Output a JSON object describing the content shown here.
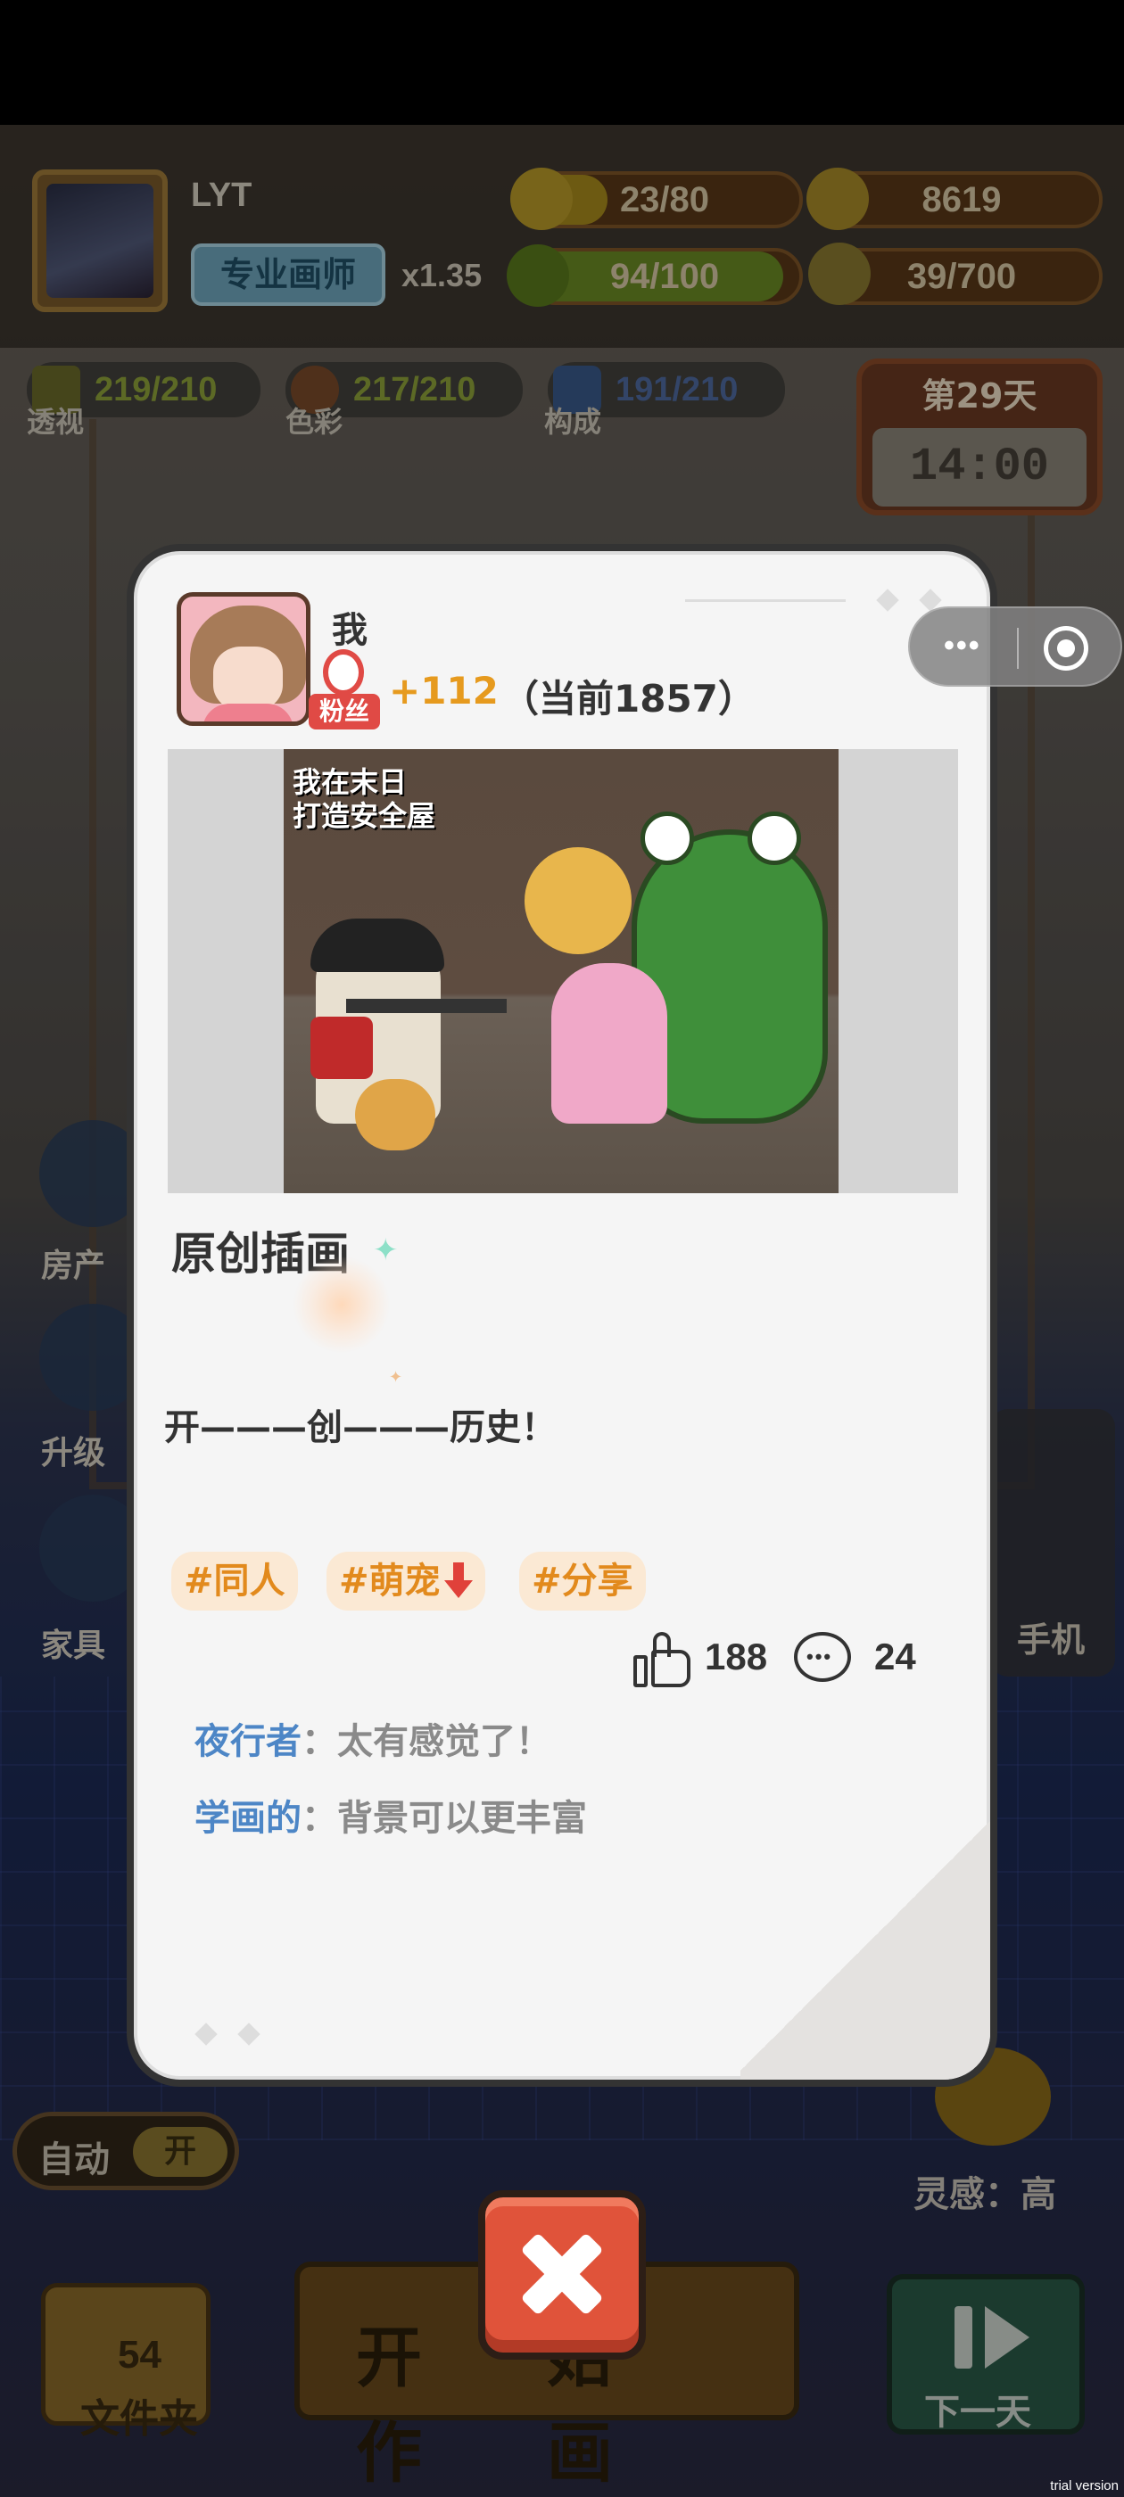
{
  "hud": {
    "player_name": "LYT",
    "title_badge": "专业画师",
    "multiplier": "x1.35",
    "energy": {
      "text": "23/80",
      "fill": 0.2875,
      "icon": "lightning-icon"
    },
    "coins": {
      "text": "8619",
      "icon": "coin-icon"
    },
    "health": {
      "text": "94/100",
      "fill": 0.94,
      "icon": "heart-icon"
    },
    "inspiration_points": {
      "text": "39/700",
      "icon": "lightbulb-icon"
    }
  },
  "skills": [
    {
      "value": "219/210",
      "label": "透视",
      "icon": "ruler-triangle-icon"
    },
    {
      "value": "217/210",
      "label": "色彩",
      "icon": "palette-icon"
    },
    {
      "value": "191/210",
      "label": "构成",
      "icon": "camera-icon"
    }
  ],
  "calendar": {
    "day": "第29天",
    "time": "14:00"
  },
  "side_menu": [
    {
      "label": "房产",
      "icon": "building-icon"
    },
    {
      "label": "升级",
      "icon": "brush-icon"
    },
    {
      "label": "家具",
      "icon": "furniture-icon"
    }
  ],
  "capsule": {
    "more_icon": "more-dots-icon",
    "close_icon": "target-circle-icon"
  },
  "post": {
    "author": "我",
    "fans_badge": "粉丝",
    "fan_gain": "+112",
    "fan_total": "（当前1857）",
    "artwork_logo": "我在末日\n打造安全屋",
    "title": "原创插画",
    "body": "开———创———历史！",
    "tags": [
      {
        "label": "#同人",
        "trend": ""
      },
      {
        "label": "#萌宠",
        "trend": "down"
      },
      {
        "label": "#分享",
        "trend": ""
      }
    ],
    "likes": "188",
    "comments_count": "24",
    "comments": [
      {
        "author": "夜行者",
        "sep": "：",
        "text": "太有感觉了！"
      },
      {
        "author": "学画的",
        "sep": "：",
        "text": "背景可以更丰富"
      }
    ]
  },
  "close_button": {
    "icon": "close-x-icon"
  },
  "bottom": {
    "auto_label": "自动",
    "auto_state": "开",
    "folder_count": "54",
    "folder_label": "文件夹",
    "start_label": "开始作画",
    "next_day_label": "下一天",
    "inspiration_label": "灵感：高",
    "phone_label": "手机"
  },
  "watermark": "trial version",
  "colors": {
    "accent_orange": "#e69a1e",
    "comment_blue": "#4d86c6",
    "close_red": "#e0533a",
    "fans_red": "#e04a45"
  }
}
